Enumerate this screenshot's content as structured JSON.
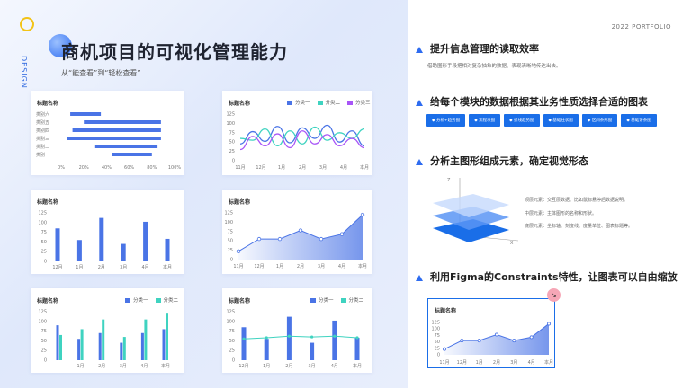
{
  "slide": {
    "vertical_label": "DESIGN",
    "title": "商机项目的可视化管理能力",
    "subtitle": "从“能查看”到“轻松查看”",
    "portfolio": "2022 PORTFOLIO"
  },
  "cards": {
    "c1": {
      "title": "标题名称"
    },
    "c2": {
      "title": "标题名称",
      "legend": [
        "分类一",
        "分类二",
        "分类三"
      ]
    },
    "c3": {
      "title": "标题名称"
    },
    "c4": {
      "title": "标题名称"
    },
    "c5": {
      "title": "标题名称",
      "legend": [
        "分类一",
        "分类二"
      ]
    },
    "c6": {
      "title": "标题名称",
      "legend": [
        "分类一",
        "分类二"
      ]
    }
  },
  "chart_data": [
    {
      "type": "bar",
      "orientation": "horizontal-range",
      "categories": [
        "类别六",
        "类别五",
        "类别四",
        "类别三",
        "类别二",
        "类别一"
      ],
      "ranges": [
        [
          8,
          35
        ],
        [
          20,
          88
        ],
        [
          10,
          88
        ],
        [
          5,
          88
        ],
        [
          30,
          85
        ],
        [
          45,
          80
        ]
      ],
      "xticks": [
        "0%",
        "20%",
        "40%",
        "60%",
        "80%",
        "100%"
      ],
      "xlim": [
        0,
        100
      ],
      "colors": [
        "#4a74e6"
      ]
    },
    {
      "type": "line",
      "categories": [
        "11月",
        "12月",
        "1月",
        "2月",
        "3月",
        "4月",
        "本月"
      ],
      "yticks": [
        "125",
        "100",
        "75",
        "50",
        "25",
        "0"
      ],
      "ylim": [
        0,
        125
      ],
      "series": [
        {
          "name": "分类一",
          "color": "#4a74e6",
          "values": [
            45,
            78,
            52,
            92,
            48,
            88,
            60,
            95,
            50,
            80,
            40
          ]
        },
        {
          "name": "分类二",
          "color": "#3fd3c0",
          "values": [
            60,
            55,
            85,
            40,
            80,
            45,
            90,
            55,
            75,
            60,
            85
          ]
        },
        {
          "name": "分类三",
          "color": "#a855f7",
          "values": [
            30,
            65,
            40,
            72,
            35,
            80,
            45,
            70,
            40,
            60,
            35
          ]
        }
      ]
    },
    {
      "type": "bar",
      "categories": [
        "12月",
        "1月",
        "2月",
        "3月",
        "4月",
        "本月"
      ],
      "values": [
        85,
        55,
        112,
        45,
        102,
        58
      ],
      "yticks": [
        "125",
        "100",
        "75",
        "50",
        "25",
        "0"
      ],
      "ylim": [
        0,
        125
      ],
      "colors": [
        "#4a74e6"
      ]
    },
    {
      "type": "area",
      "categories": [
        "11月",
        "12月",
        "1月",
        "2月",
        "3月",
        "4月",
        "本月"
      ],
      "values": [
        22,
        55,
        55,
        78,
        55,
        68,
        120
      ],
      "yticks": [
        "125",
        "100",
        "75",
        "50",
        "25",
        "0"
      ],
      "ylim": [
        0,
        125
      ],
      "colors": [
        "#4a74e6"
      ]
    },
    {
      "type": "bar",
      "categories": [
        "1月",
        "2月",
        "3月",
        "4月",
        "本月"
      ],
      "series": [
        {
          "name": "分类一",
          "color": "#4a74e6",
          "values": [
            90,
            55,
            70,
            45,
            70,
            80
          ]
        },
        {
          "name": "分类二",
          "color": "#3fd3c0",
          "values": [
            65,
            80,
            105,
            60,
            105,
            120
          ]
        }
      ],
      "yticks": [
        "125",
        "100",
        "75",
        "50",
        "25",
        "0"
      ],
      "ylim": [
        0,
        125
      ]
    },
    {
      "type": "bar",
      "categories": [
        "12月",
        "1月",
        "2月",
        "3月",
        "4月",
        "本月"
      ],
      "series": [
        {
          "name": "分类一",
          "color": "#4a74e6",
          "values": [
            85,
            55,
            112,
            45,
            102,
            58
          ]
        },
        {
          "name": "分类二",
          "color": "#3fd3c0",
          "values": [
            55,
            58,
            62,
            60,
            62,
            58
          ]
        }
      ],
      "yticks": [
        "125",
        "100",
        "75",
        "50",
        "25",
        "0"
      ],
      "ylim": [
        0,
        125
      ]
    }
  ],
  "sections": [
    {
      "title": "提升信息管理的读取效率",
      "desc": "借助图形手段把相对复杂抽象的数据、表现清晰地传达出去。"
    },
    {
      "title": "给每个模块的数据根据其业务性质选择合适的图表",
      "buttons": [
        "分析+趋势图",
        "流程块图",
        "折线趋势图",
        "基础柱状图",
        "区间条形图",
        "基础饼条图"
      ]
    },
    {
      "title": "分析主图形组成元素，确定视觉形态",
      "layers": [
        "顶层元素：交互层数据、比如鼠标悬停后数据说明。",
        "中层元素：主体图形的名称和形状。",
        "底层元素：坐标轴、刻度线、度量单位、图表标题等。"
      ],
      "axis": {
        "z": "Z",
        "x": "X"
      }
    },
    {
      "title": "利用Figma的Constraints特性，让图表可以自由缩放",
      "mini_chart": {
        "title": "标题名称",
        "yticks": [
          "125",
          "100",
          "75",
          "50",
          "25",
          "0"
        ],
        "categories": [
          "11月",
          "12月",
          "1月",
          "2月",
          "3月",
          "4月",
          "本月"
        ],
        "values": [
          22,
          55,
          55,
          78,
          55,
          68,
          120
        ]
      }
    }
  ],
  "icons": {
    "resize": "resize-arrow-icon"
  },
  "colors": {
    "primary": "#1a6ee8",
    "accent": "#f2c318",
    "teal": "#3fd3c0",
    "purple": "#a855f7"
  }
}
